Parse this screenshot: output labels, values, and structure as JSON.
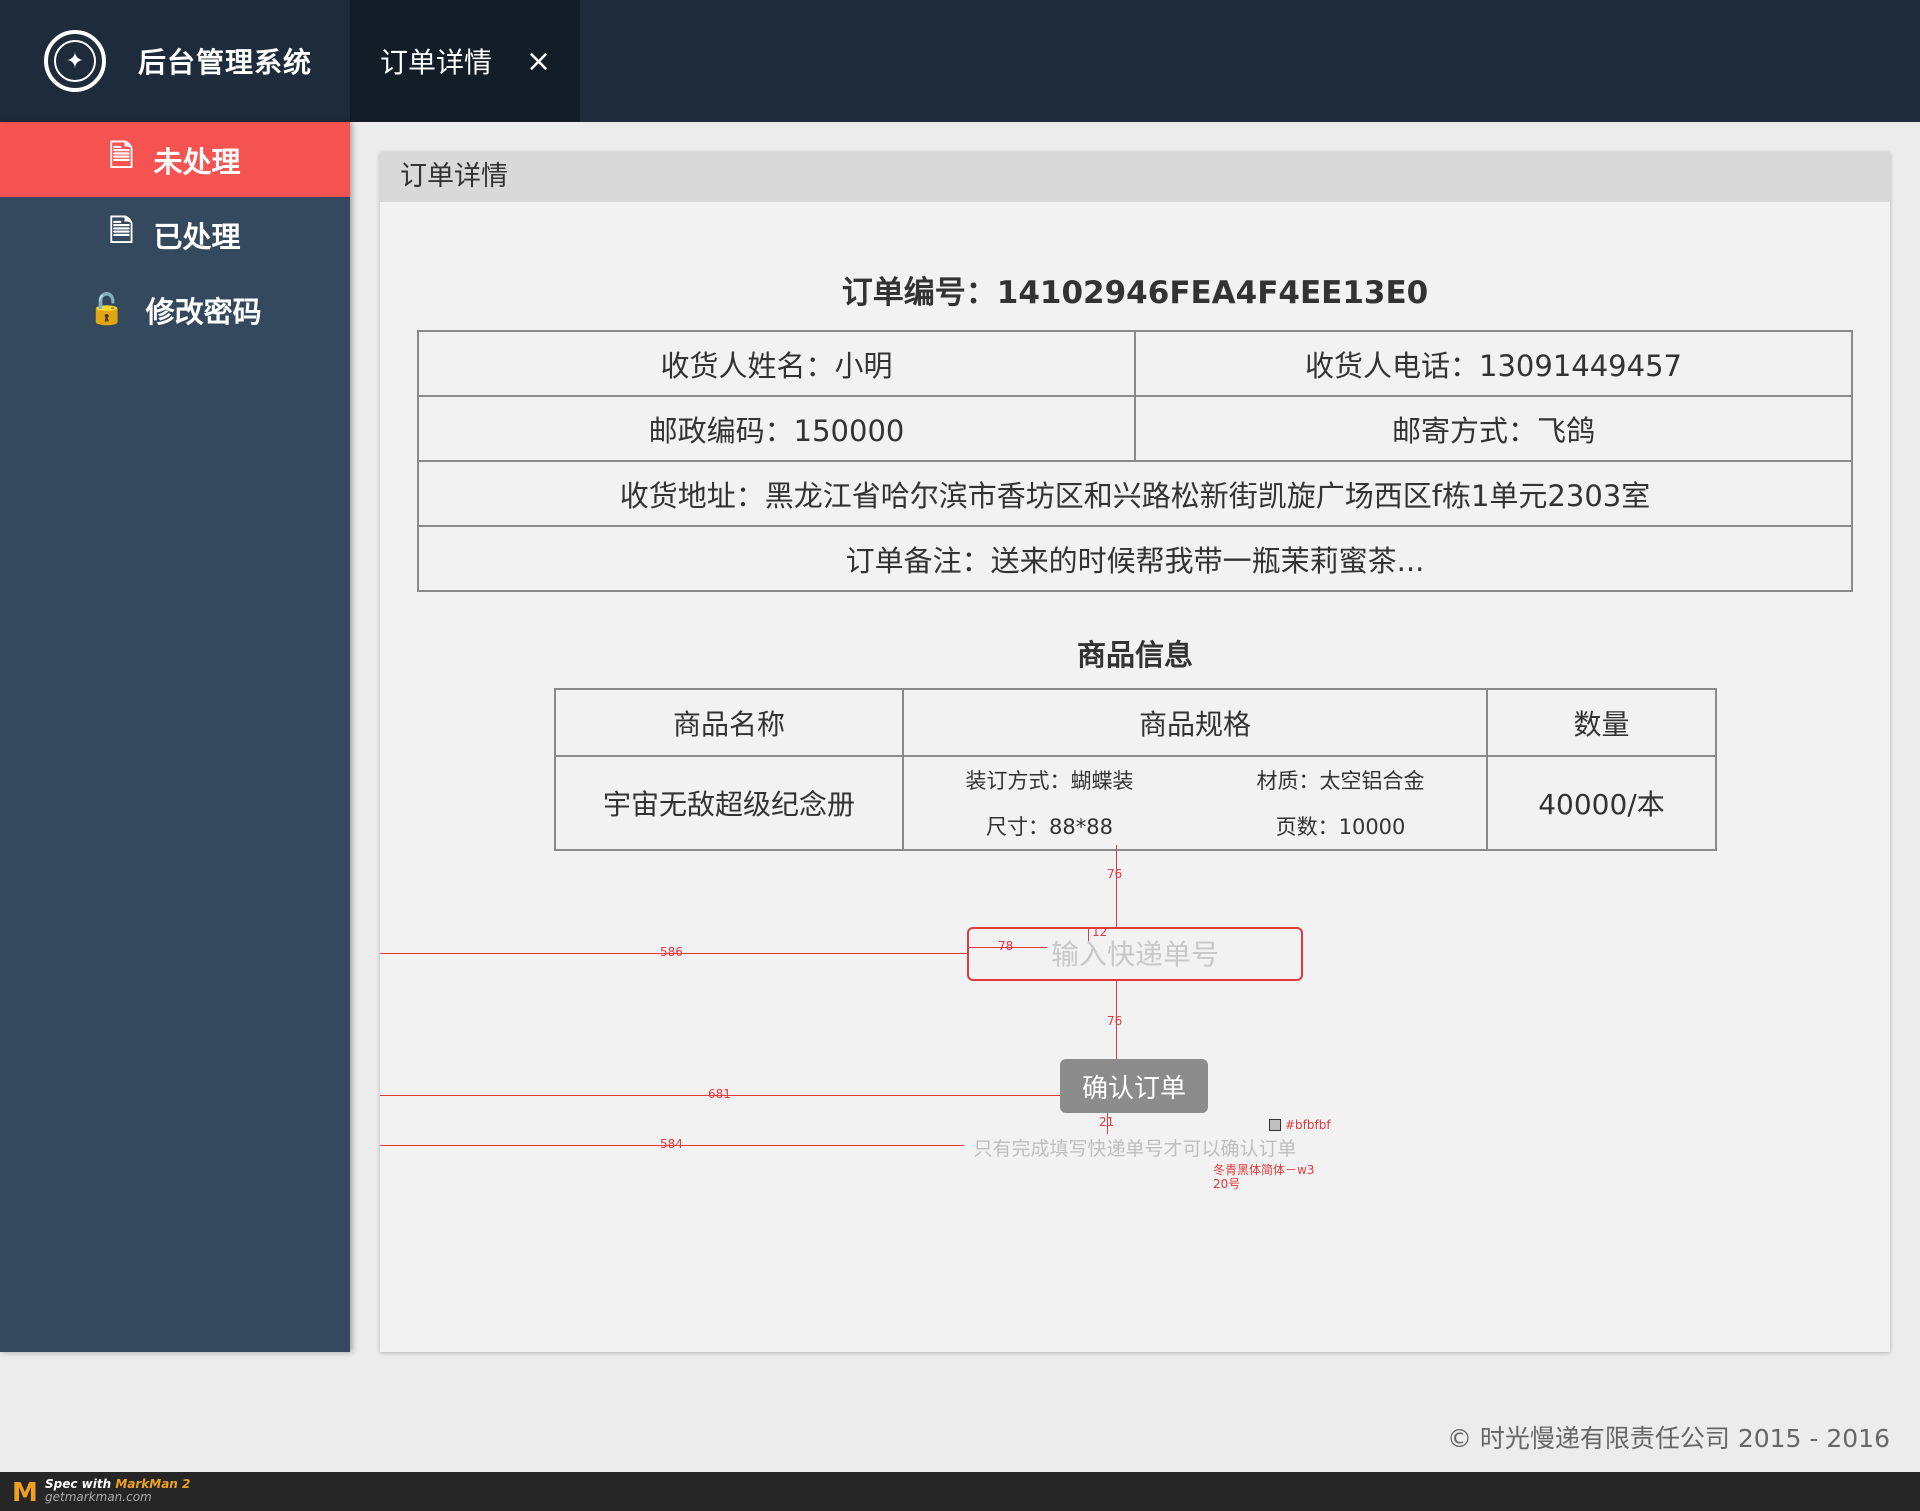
{
  "header": {
    "logo_icon": "compass-logo",
    "title": "后台管理系统",
    "tab_label": "订单详情",
    "tab_close_icon": "close-icon",
    "close_glyph": "×"
  },
  "sidebar": {
    "items": [
      {
        "label": "未处理",
        "icon": "document-icon",
        "glyph": "🗎",
        "active": true
      },
      {
        "label": "已处理",
        "icon": "document-check-icon",
        "glyph": "🗎",
        "active": false
      },
      {
        "label": "修改密码",
        "icon": "unlock-icon",
        "glyph": "🔓",
        "active": false
      }
    ]
  },
  "panel": {
    "title": "订单详情",
    "order_no": "订单编号：14102946FEA4F4EE13E0",
    "receiver_name": "收货人姓名：小明",
    "receiver_phone": "收货人电话：13091449457",
    "postcode": "邮政编码：150000",
    "shipping_method": "邮寄方式：飞鸽",
    "address": "收货地址：黑龙江省哈尔滨市香坊区和兴路松新街凯旋广场西区f栋1单元2303室",
    "remark": "订单备注：送来的时候帮我带一瓶茉莉蜜茶..."
  },
  "goods": {
    "title": "商品信息",
    "headers": [
      "商品名称",
      "商品规格",
      "数量"
    ],
    "row": {
      "name": "宇宙无敌超级纪念册",
      "spec": [
        "装订方式：蝴蝶装",
        "材质：太空铝合金",
        "尺寸：88*88",
        "页数：10000"
      ],
      "qty": "40000/本"
    }
  },
  "form": {
    "express_placeholder": "输入快递单号",
    "express_value": "",
    "confirm_label": "确认订单",
    "hint": "只有完成填写快递单号才可以确认订单"
  },
  "annotations": {
    "gap_top": "76",
    "padding": "12",
    "inner_left": "78",
    "input_left": "586",
    "gap_mid": "76",
    "button_left": "681",
    "gap_hint": "21",
    "hint_left": "584",
    "hint_color": "#bfbfbf",
    "font_note": "冬青黑体简体－w3",
    "font_size_note": "20号"
  },
  "footer": {
    "copyright": "© 时光慢递有限责任公司 2015 - 2016"
  },
  "markman": {
    "spec_with": "Spec with",
    "product": "MarkMan 2",
    "site": "getmarkman.com"
  },
  "colors": {
    "topbar": "#1e2b3b",
    "sidebar": "#34495e",
    "active": "#f55252",
    "button": "#8c8c8c",
    "hint": "#bfbfbf"
  }
}
